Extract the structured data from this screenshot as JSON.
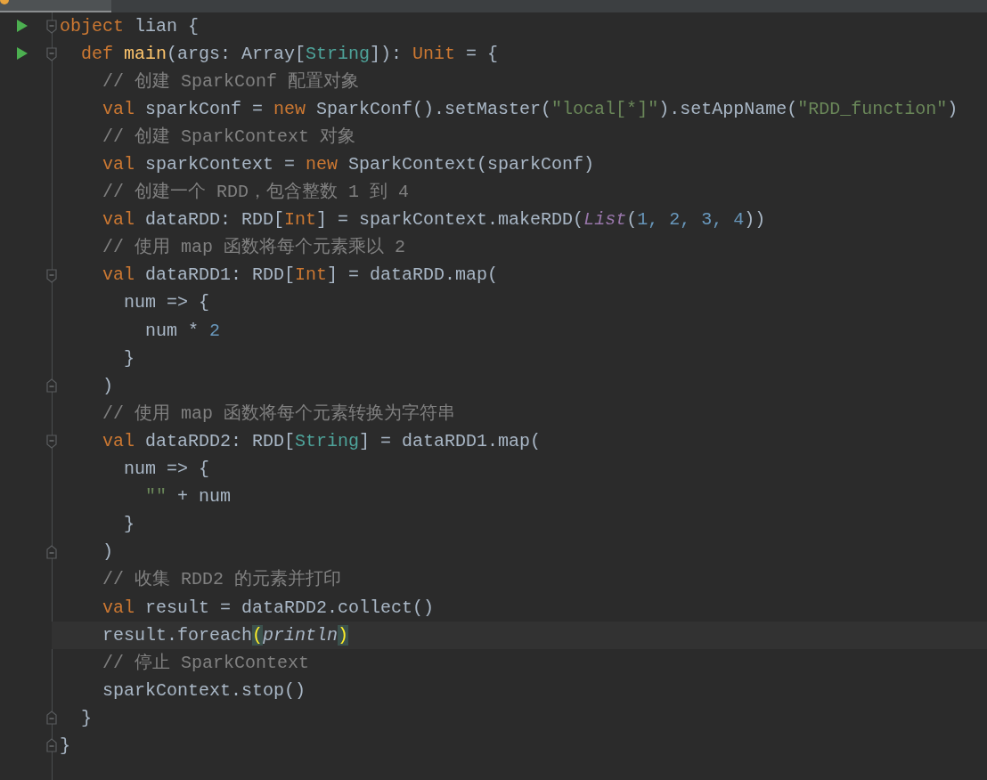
{
  "editor": {
    "lines": [
      {
        "run": true,
        "fold_open": true,
        "fold_close": false,
        "selected": false,
        "tokens": [
          {
            "kind": "kw",
            "text": "object"
          },
          {
            "kind": "id",
            "text": " lian {"
          }
        ]
      },
      {
        "run": true,
        "fold_open": true,
        "fold_close": false,
        "selected": false,
        "tokens": [
          {
            "kind": "kw",
            "text": "  def "
          },
          {
            "kind": "fn",
            "text": "main"
          },
          {
            "kind": "id",
            "text": "(args: Array["
          },
          {
            "kind": "type",
            "text": "String"
          },
          {
            "kind": "id",
            "text": "]): "
          },
          {
            "kind": "kw",
            "text": "Unit"
          },
          {
            "kind": "id",
            "text": " = {"
          }
        ]
      },
      {
        "run": false,
        "fold_open": false,
        "fold_close": false,
        "selected": false,
        "tokens": [
          {
            "kind": "cmt",
            "text": "    // 创建 SparkConf 配置对象"
          }
        ]
      },
      {
        "run": false,
        "fold_open": false,
        "fold_close": false,
        "selected": false,
        "tokens": [
          {
            "kind": "kw",
            "text": "    val"
          },
          {
            "kind": "id",
            "text": " sparkConf = "
          },
          {
            "kind": "kw",
            "text": "new"
          },
          {
            "kind": "id",
            "text": " SparkConf().setMaster("
          },
          {
            "kind": "str",
            "text": "\"local[*]\""
          },
          {
            "kind": "id",
            "text": ").setAppName("
          },
          {
            "kind": "str",
            "text": "\"RDD_function\""
          },
          {
            "kind": "id",
            "text": ")"
          }
        ]
      },
      {
        "run": false,
        "fold_open": false,
        "fold_close": false,
        "selected": false,
        "tokens": [
          {
            "kind": "cmt",
            "text": "    // 创建 SparkContext 对象"
          }
        ]
      },
      {
        "run": false,
        "fold_open": false,
        "fold_close": false,
        "selected": false,
        "tokens": [
          {
            "kind": "kw",
            "text": "    val"
          },
          {
            "kind": "id",
            "text": " sparkContext = "
          },
          {
            "kind": "kw",
            "text": "new"
          },
          {
            "kind": "id",
            "text": " SparkContext(sparkConf)"
          }
        ]
      },
      {
        "run": false,
        "fold_open": false,
        "fold_close": false,
        "selected": false,
        "tokens": [
          {
            "kind": "cmt",
            "text": "    // 创建一个 RDD，包含整数 1 到 4"
          }
        ]
      },
      {
        "run": false,
        "fold_open": false,
        "fold_close": false,
        "selected": false,
        "tokens": [
          {
            "kind": "kw",
            "text": "    val"
          },
          {
            "kind": "id",
            "text": " dataRDD: RDD["
          },
          {
            "kind": "kw",
            "text": "Int"
          },
          {
            "kind": "id",
            "text": "] = sparkContext.makeRDD("
          },
          {
            "kind": "italic",
            "text": "List"
          },
          {
            "kind": "id",
            "text": "("
          },
          {
            "kind": "num",
            "text": "1, 2, 3, 4"
          },
          {
            "kind": "id",
            "text": "))"
          }
        ]
      },
      {
        "run": false,
        "fold_open": false,
        "fold_close": false,
        "selected": false,
        "tokens": [
          {
            "kind": "cmt",
            "text": "    // 使用 map 函数将每个元素乘以 2"
          }
        ]
      },
      {
        "run": false,
        "fold_open": true,
        "fold_close": false,
        "selected": false,
        "tokens": [
          {
            "kind": "kw",
            "text": "    val"
          },
          {
            "kind": "id",
            "text": " dataRDD1: RDD["
          },
          {
            "kind": "kw",
            "text": "Int"
          },
          {
            "kind": "id",
            "text": "] = dataRDD.map("
          }
        ]
      },
      {
        "run": false,
        "fold_open": false,
        "fold_close": false,
        "selected": false,
        "tokens": [
          {
            "kind": "id",
            "text": "      num => {"
          }
        ]
      },
      {
        "run": false,
        "fold_open": false,
        "fold_close": false,
        "selected": false,
        "tokens": [
          {
            "kind": "id",
            "text": "        num * "
          },
          {
            "kind": "num",
            "text": "2"
          }
        ]
      },
      {
        "run": false,
        "fold_open": false,
        "fold_close": false,
        "selected": false,
        "tokens": [
          {
            "kind": "id",
            "text": "      }"
          }
        ]
      },
      {
        "run": false,
        "fold_open": false,
        "fold_close": true,
        "selected": false,
        "tokens": [
          {
            "kind": "id",
            "text": "    )"
          }
        ]
      },
      {
        "run": false,
        "fold_open": false,
        "fold_close": false,
        "selected": false,
        "tokens": [
          {
            "kind": "cmt",
            "text": "    // 使用 map 函数将每个元素转换为字符串"
          }
        ]
      },
      {
        "run": false,
        "fold_open": true,
        "fold_close": false,
        "selected": false,
        "tokens": [
          {
            "kind": "kw",
            "text": "    val"
          },
          {
            "kind": "id",
            "text": " dataRDD2: RDD["
          },
          {
            "kind": "type",
            "text": "String"
          },
          {
            "kind": "id",
            "text": "] = dataRDD1.map("
          }
        ]
      },
      {
        "run": false,
        "fold_open": false,
        "fold_close": false,
        "selected": false,
        "tokens": [
          {
            "kind": "id",
            "text": "      num => {"
          }
        ]
      },
      {
        "run": false,
        "fold_open": false,
        "fold_close": false,
        "selected": false,
        "tokens": [
          {
            "kind": "str",
            "text": "        \"\""
          },
          {
            "kind": "id",
            "text": " + num"
          }
        ]
      },
      {
        "run": false,
        "fold_open": false,
        "fold_close": false,
        "selected": false,
        "tokens": [
          {
            "kind": "id",
            "text": "      }"
          }
        ]
      },
      {
        "run": false,
        "fold_open": false,
        "fold_close": true,
        "selected": false,
        "tokens": [
          {
            "kind": "id",
            "text": "    )"
          }
        ]
      },
      {
        "run": false,
        "fold_open": false,
        "fold_close": false,
        "selected": false,
        "tokens": [
          {
            "kind": "cmt",
            "text": "    // 收集 RDD2 的元素并打印"
          }
        ]
      },
      {
        "run": false,
        "fold_open": false,
        "fold_close": false,
        "selected": false,
        "tokens": [
          {
            "kind": "kw",
            "text": "    val"
          },
          {
            "kind": "id",
            "text": " result = dataRDD2.collect()"
          }
        ]
      },
      {
        "run": false,
        "fold_open": false,
        "fold_close": false,
        "selected": true,
        "tokens": [
          {
            "kind": "id",
            "text": "    result.foreach"
          },
          {
            "kind": "match",
            "text": "("
          },
          {
            "kind": "italic-plain",
            "text": "println"
          },
          {
            "kind": "match",
            "text": ")"
          }
        ]
      },
      {
        "run": false,
        "fold_open": false,
        "fold_close": false,
        "selected": false,
        "tokens": [
          {
            "kind": "cmt",
            "text": "    // 停止 SparkContext"
          }
        ]
      },
      {
        "run": false,
        "fold_open": false,
        "fold_close": false,
        "selected": false,
        "tokens": [
          {
            "kind": "id",
            "text": "    sparkContext.stop()"
          }
        ]
      },
      {
        "run": false,
        "fold_open": false,
        "fold_close": true,
        "selected": false,
        "tokens": [
          {
            "kind": "id",
            "text": "  }"
          }
        ]
      },
      {
        "run": false,
        "fold_open": false,
        "fold_close": true,
        "selected": false,
        "tokens": [
          {
            "kind": "id",
            "text": "}"
          }
        ]
      }
    ]
  }
}
